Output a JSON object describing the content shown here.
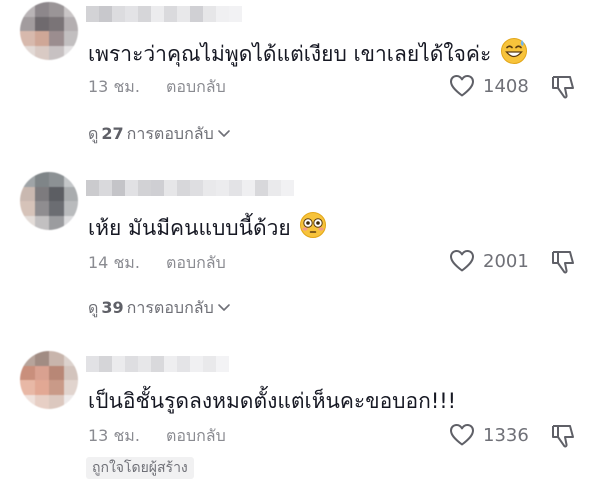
{
  "comments": [
    {
      "text": "เพราะว่าคุณไม่พูดได้แต่เงียบ เขาเลยได้ใจค่ะ",
      "emoji": "grinning-sweat-emoji",
      "time": "13 ชม.",
      "reply_label": "ตอบกลับ",
      "likes": "1408",
      "view_replies": {
        "prefix": "ดู",
        "count": "27",
        "suffix": "การตอบกลับ"
      }
    },
    {
      "text": "เห้ย มันมีคนแบบนี้ด้วย",
      "emoji": "flushed-face-emoji",
      "time": "14 ชม.",
      "reply_label": "ตอบกลับ",
      "likes": "2001",
      "view_replies": {
        "prefix": "ดู",
        "count": "39",
        "suffix": "การตอบกลับ"
      }
    },
    {
      "text": "เป็นอิชั้นรูดลงหมดตั้งแต่เห็นคะขอบอก!!!",
      "time": "13 ชม.",
      "reply_label": "ตอบกลับ",
      "likes": "1336",
      "creator_badge": "ถูกใจโดยผู้สร้าง"
    }
  ],
  "icons": {
    "like": "heart-outline-icon",
    "dislike": "thumbs-down-outline-icon",
    "expand": "chevron-down-icon"
  },
  "colors": {
    "text": "#161823",
    "secondary": "#8a8b91",
    "badge_bg": "#f1f1f2"
  }
}
